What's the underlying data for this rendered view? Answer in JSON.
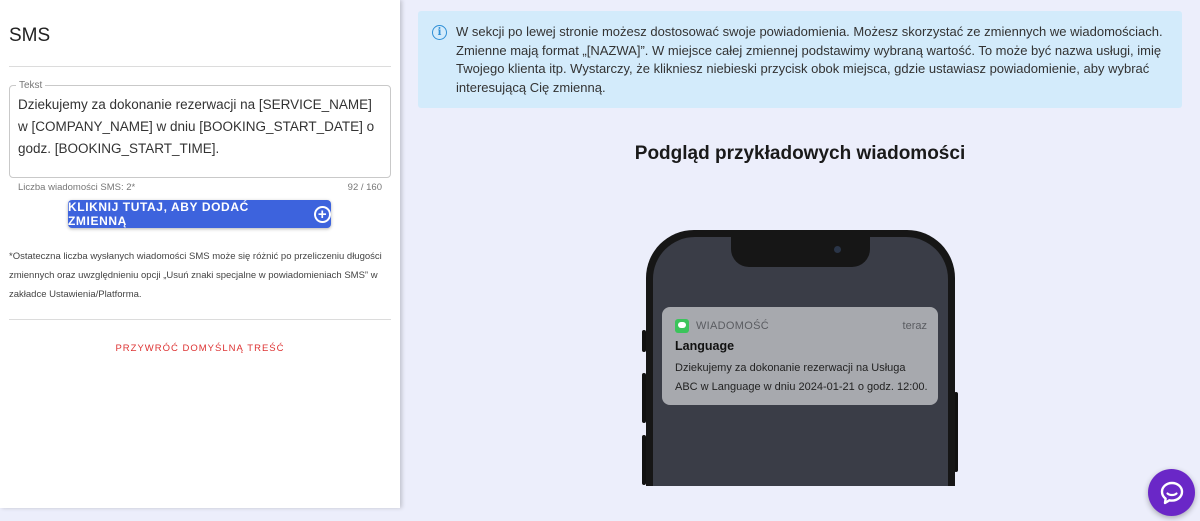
{
  "sms_panel": {
    "title": "SMS",
    "textarea_label": "Tekst",
    "message_text": "Dziekujemy za dokonanie rezerwacji na [SERVICE_NAME] w [COMPANY_NAME] w dniu [BOOKING_START_DATE] o godz. [BOOKING_START_TIME].",
    "sms_count_label": "Liczba wiadomości SMS: 2*",
    "char_counter": "92 / 160",
    "add_variable_button": "KLIKNIJ TUTAJ, ABY DODAĆ ZMIENNĄ",
    "footnote": "*Ostateczna liczba wysłanych wiadomości SMS może się różnić po przeliczeniu długości zmiennych oraz uwzględnieniu opcji „Usuń znaki specjalne w powiadomieniach SMS” w zakładce Ustawienia/Platforma.",
    "restore_default_link": "PRZYWRÓĆ DOMYŚLNĄ TREŚĆ"
  },
  "info_box": {
    "icon": "info-icon",
    "text": "W sekcji po lewej stronie możesz dostosować swoje powiadomienia. Możesz skorzystać ze zmiennych we wiadomościach. Zmienne mają format „[NAZWA]”. W miejsce całej zmiennej podstawimy wybraną wartość. To może być nazwa usługi, imię Twojego klienta itp. Wystarczy, że klikniesz niebieski przycisk obok miejsca, gdzie ustawiasz powiadomienie, aby wybrać interesującą Cię zmienną."
  },
  "preview": {
    "heading": "Podgląd przykładowych wiadomości",
    "notification": {
      "app_name": "WIADOMOŚĆ",
      "time": "teraz",
      "title": "Language",
      "body": "Dziekujemy za dokonanie rezerwacji na Usługa ABC w Language w dniu 2024-01-21 o godz. 12:00."
    }
  },
  "colors": {
    "accent_button": "#3d63dd",
    "restore_link": "#dd3333",
    "info_background": "#d3ebfb",
    "page_background": "#eceefb",
    "chat_fab": "#6a27c7"
  }
}
